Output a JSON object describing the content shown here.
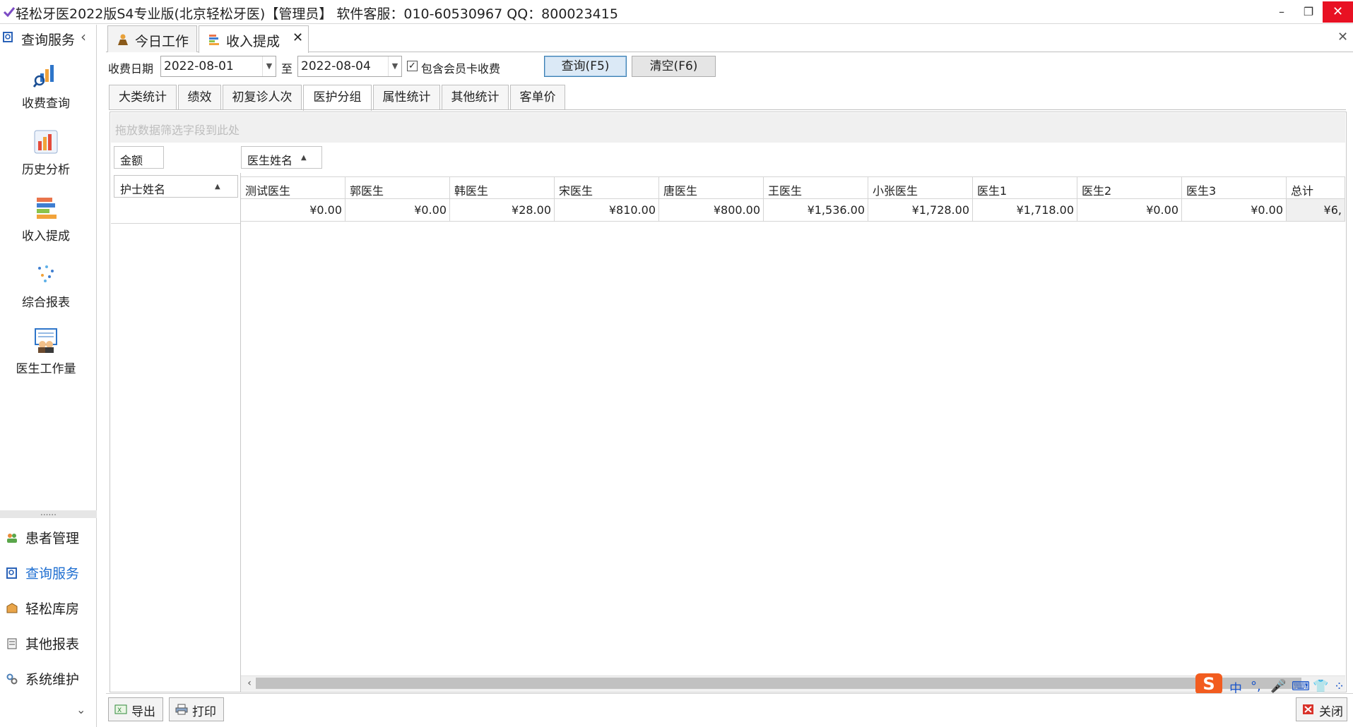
{
  "window": {
    "title": "轻松牙医2022版S4专业版(北京轻松牙医)【管理员】    软件客服：010-60530967 QQ：800023415",
    "minimize": "–",
    "restore": "❐",
    "close": "✕"
  },
  "sidebar": {
    "header": "查询服务",
    "collapse": "‹",
    "big_items": [
      {
        "label": "收费查询",
        "icon": "bar-chart-search-icon"
      },
      {
        "label": "历史分析",
        "icon": "history-chart-icon"
      },
      {
        "label": "收入提成",
        "icon": "stacked-bars-icon"
      },
      {
        "label": "综合报表",
        "icon": "dots-report-icon"
      },
      {
        "label": "医生工作量",
        "icon": "doctor-board-icon"
      }
    ],
    "splitter": "......",
    "nav_items": [
      {
        "label": "患者管理",
        "icon": "patients-icon"
      },
      {
        "label": "查询服务",
        "icon": "query-icon",
        "active": true
      },
      {
        "label": "轻松库房",
        "icon": "warehouse-icon"
      },
      {
        "label": "其他报表",
        "icon": "reports-icon"
      },
      {
        "label": "系统维护",
        "icon": "settings-icon"
      }
    ],
    "more": "⌄"
  },
  "doc_tabs": [
    {
      "label": "今日工作",
      "icon": "work-person-icon"
    },
    {
      "label": "收入提成",
      "icon": "stacked-bars-icon",
      "active": true,
      "close": "✕"
    }
  ],
  "main_close": "✕",
  "filter": {
    "date_label": "收费日期",
    "date_from": "2022-08-01",
    "to_label": "至",
    "date_to": "2022-08-04",
    "include_member_checked": true,
    "include_member_label": "包含会员卡收费",
    "query_button": "查询(F5)",
    "clear_button": "清空(F6)"
  },
  "sub_tabs": [
    "大类统计",
    "绩效",
    "初复诊人次",
    "医护分组",
    "属性统计",
    "其他统计",
    "客单价"
  ],
  "sub_tab_active": 3,
  "pivot": {
    "filter_hint": "拖放数据筛选字段到此处",
    "data_field": "金额",
    "column_field": "医生姓名",
    "row_field": "护士姓名",
    "columns": [
      "测试医生",
      "郭医生",
      "韩医生",
      "宋医生",
      "唐医生",
      "王医生",
      "小张医生",
      "医生1",
      "医生2",
      "医生3",
      "总计"
    ],
    "values": [
      "¥0.00",
      "¥0.00",
      "¥28.00",
      "¥810.00",
      "¥800.00",
      "¥1,536.00",
      "¥1,728.00",
      "¥1,718.00",
      "¥0.00",
      "¥0.00",
      "¥6,"
    ]
  },
  "ime": {
    "logo": "S",
    "items": [
      "中",
      "°,",
      "🎤",
      "⌨",
      "👕",
      "⁘"
    ]
  },
  "bottom": {
    "export": "导出",
    "print": "打印",
    "close": "关闭"
  }
}
